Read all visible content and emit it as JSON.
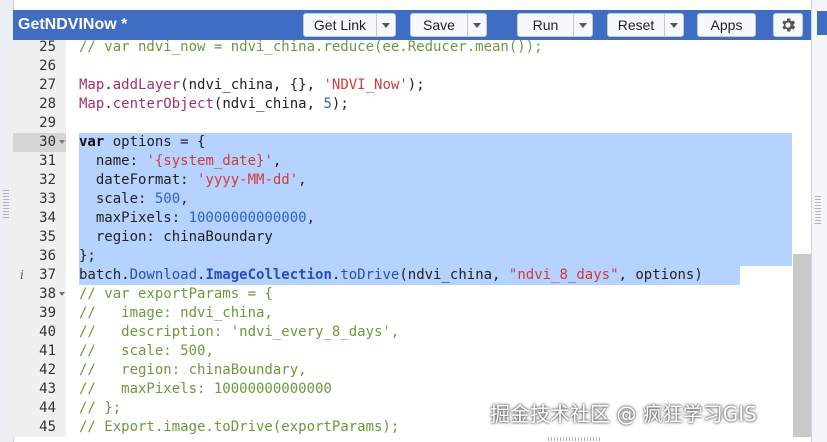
{
  "header": {
    "title": "GetNDVINow *",
    "buttons": {
      "get_link": "Get Link",
      "save": "Save",
      "run": "Run",
      "reset": "Reset",
      "apps": "Apps"
    }
  },
  "editor": {
    "lines": [
      {
        "n": "25",
        "text": "// var ndvi_now = ndvi_china.reduce(ee.Reducer.mean());"
      },
      {
        "n": "26",
        "text": ""
      },
      {
        "n": "27",
        "text": "Map.addLayer(ndvi_china, {}, 'NDVI_Now');"
      },
      {
        "n": "28",
        "text": "Map.centerObject(ndvi_china, 5);"
      },
      {
        "n": "29",
        "text": ""
      },
      {
        "n": "30",
        "text": "var options = {"
      },
      {
        "n": "31",
        "text": "  name: '{system_date}',"
      },
      {
        "n": "32",
        "text": "  dateFormat: 'yyyy-MM-dd',"
      },
      {
        "n": "33",
        "text": "  scale: 500,"
      },
      {
        "n": "34",
        "text": "  maxPixels: 10000000000000,"
      },
      {
        "n": "35",
        "text": "  region: chinaBoundary"
      },
      {
        "n": "36",
        "text": "};"
      },
      {
        "n": "37",
        "text": "batch.Download.ImageCollection.toDrive(ndvi_china, \"ndvi_8_days\", options)"
      },
      {
        "n": "38",
        "text": "// var exportParams = {"
      },
      {
        "n": "39",
        "text": "//   image: ndvi_china,"
      },
      {
        "n": "40",
        "text": "//   description: 'ndvi_every_8_days',"
      },
      {
        "n": "41",
        "text": "//   scale: 500,"
      },
      {
        "n": "42",
        "text": "//   region: chinaBoundary,"
      },
      {
        "n": "43",
        "text": "//   maxPixels: 10000000000000"
      },
      {
        "n": "44",
        "text": "// };"
      },
      {
        "n": "45",
        "text": "// Export.image.toDrive(exportParams);"
      }
    ]
  },
  "watermark": "掘金技术社区 @ 疯狂学习GIS",
  "colors": {
    "header": "#3e6dc3",
    "selection": "#b5d3fe",
    "comment": "#6b9a3c",
    "string": "#d33a3a",
    "number": "#2f63c7",
    "property": "#a2306f"
  },
  "icons": {
    "settings": "gear-icon",
    "info": "info-icon",
    "fold": "fold-arrow-icon"
  }
}
